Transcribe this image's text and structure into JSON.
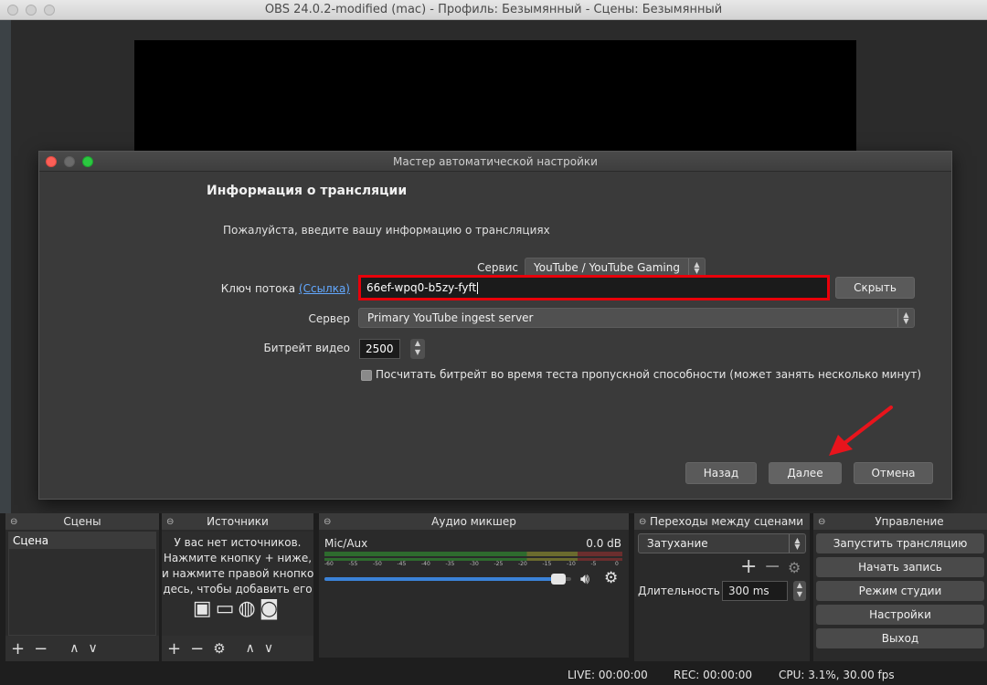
{
  "window": {
    "title": "OBS 24.0.2-modified (mac) - Профиль: Безымянный - Сцены: Безымянный"
  },
  "dialog": {
    "title": "Мастер автоматической настройки",
    "heading": "Информация о трансляции",
    "subtitle": "Пожалуйста, введите вашу информацию о трансляциях",
    "service_label": "Сервис",
    "service_value": "YouTube / YouTube Gaming",
    "key_label": "Ключ потока",
    "key_link": "(Ссылка)",
    "key_value": "66ef-wpq0-b5zy-fyft",
    "hide_button": "Скрыть",
    "server_label": "Сервер",
    "server_value": "Primary YouTube ingest server",
    "bitrate_label": "Битрейт видео",
    "bitrate_value": "2500",
    "checkbox_label": "Посчитать битрейт во время теста пропускной способности (может занять несколько минут)",
    "back_button": "Назад",
    "next_button": "Далее",
    "cancel_button": "Отмена"
  },
  "docks": {
    "scenes": {
      "title": "Сцены",
      "items": [
        "Сцена"
      ]
    },
    "sources": {
      "title": "Источники",
      "empty_lines": [
        "У вас нет источников.",
        "Нажмите кнопку + ниже,",
        "и нажмите правой кнопко",
        "дeсь, чтобы добавить его"
      ]
    },
    "mixer": {
      "title": "Аудио микшер",
      "channel": "Mic/Aux",
      "level": "0.0 dB",
      "ticks": [
        "-60",
        "-55",
        "-50",
        "-45",
        "-40",
        "-35",
        "-30",
        "-25",
        "-20",
        "-15",
        "-10",
        "-5",
        "0"
      ],
      "volume_fraction": 0.97
    },
    "transitions": {
      "title": "Переходы между сценами",
      "transition_value": "Затухание",
      "duration_label": "Длительность",
      "duration_value": "300 ms"
    },
    "controls": {
      "title": "Управление",
      "buttons": [
        "Запустить трансляцию",
        "Начать запись",
        "Режим студии",
        "Настройки",
        "Выход"
      ]
    }
  },
  "status": {
    "live": "LIVE: 00:00:00",
    "rec": "REC: 00:00:00",
    "cpu": "CPU: 3.1%, 30.00 fps"
  },
  "colors": {
    "highlight": "#e8000a",
    "arrow": "#e8141c",
    "link": "#62a8ff",
    "volume": "#3b82d8"
  }
}
